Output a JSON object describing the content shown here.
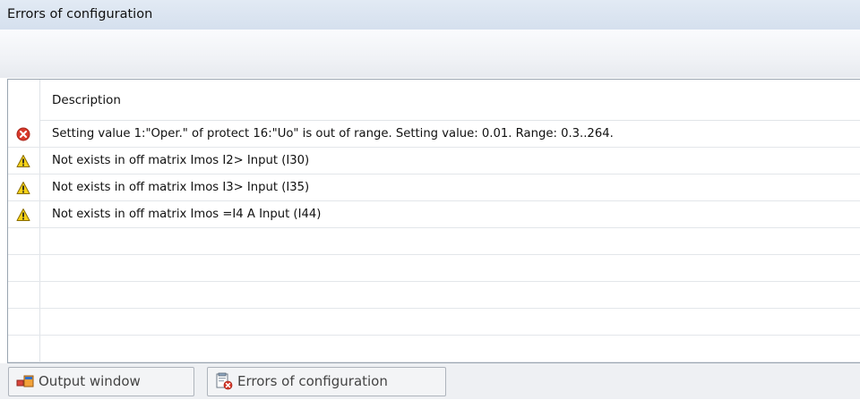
{
  "panel": {
    "title": "Errors of configuration"
  },
  "grid": {
    "column_header": "Description",
    "rows": [
      {
        "severity": "error",
        "icon": "error-icon",
        "text": "Setting value 1:\"Oper.\" of protect 16:\"Uo\" is out of range. Setting value: 0.01. Range: 0.3..264."
      },
      {
        "severity": "warning",
        "icon": "warning-icon",
        "text": "Not exists in off matrix Imos I2> Input (I30)"
      },
      {
        "severity": "warning",
        "icon": "warning-icon",
        "text": "Not exists in off matrix Imos I3> Input (I35)"
      },
      {
        "severity": "warning",
        "icon": "warning-icon",
        "text": "Not exists in off matrix Imos =I4 A Input (I44)"
      }
    ]
  },
  "tabs": [
    {
      "label": "Output window",
      "icon": "output-window-icon"
    },
    {
      "label": "Errors of configuration",
      "icon": "errors-of-configuration-icon"
    }
  ],
  "colors": {
    "title_bar": "#d5e0ee",
    "error_red": "#d8392b",
    "warning_yellow": "#f7d217"
  }
}
